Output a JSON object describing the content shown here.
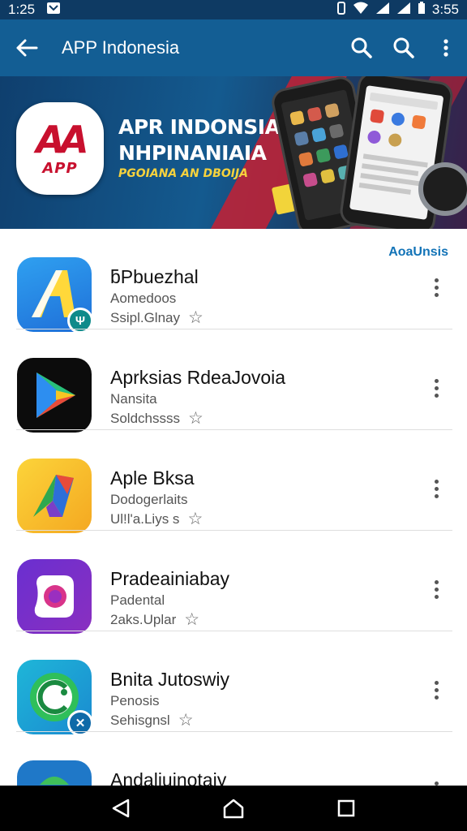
{
  "status_bar": {
    "time": "1:25",
    "battery": "3:55"
  },
  "app_bar": {
    "title": "APP Indonesia",
    "icons": [
      "back-arrow-icon",
      "search-icon",
      "search-icon",
      "more-vert-icon"
    ]
  },
  "banner": {
    "logo_mark": "AA",
    "logo_sub": "APP",
    "title_line1": "APR INDONSIAI",
    "title_line2": "NHPINANIAIA",
    "subtitle": "PGOIANA AN DBOIJA"
  },
  "list": {
    "header_link": "AoaUnsis",
    "apps": [
      {
        "name": "ƃPbuezhal",
        "developer": "Aomedoos",
        "meta": "Ssipl.Glnay",
        "icon": "arrow-a-app-icon"
      },
      {
        "name": "Aprksias RdeaJovoia",
        "developer": "Nansita",
        "meta": "Soldchssss",
        "icon": "play-triangle-app-icon"
      },
      {
        "name": "Aple Bksa",
        "developer": "Dodogerlaits",
        "meta": "Ul!l'a.Liys s",
        "icon": "blade-app-icon"
      },
      {
        "name": "Pradeainiabay",
        "developer": "Padental",
        "meta": "2aks.Uplar",
        "icon": "camera-blob-app-icon"
      },
      {
        "name": "Bnita Jutoswiy",
        "developer": "Penosis",
        "meta": "Sehisgnsl",
        "icon": "c-ring-app-icon"
      },
      {
        "name": "Andaliuinotaiy",
        "developer": "",
        "meta": "",
        "icon": "android-app-icon"
      }
    ]
  },
  "colors": {
    "status_bar": "#0e3a63",
    "app_bar": "#135e94",
    "link": "#1273b7"
  }
}
